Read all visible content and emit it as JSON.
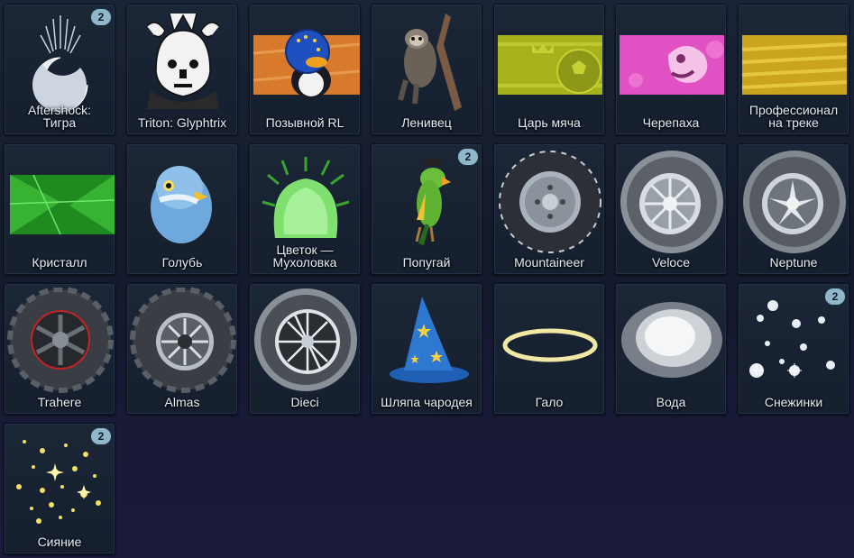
{
  "items": [
    {
      "name": "Aftershock:\nТигра",
      "badge": "2",
      "icon": "aftershock-decal-icon"
    },
    {
      "name": "Triton: Glyphtrix",
      "badge": "",
      "icon": "triton-glyphtrix-icon"
    },
    {
      "name": "Позывной RL",
      "badge": "",
      "icon": "penguin-banner-icon"
    },
    {
      "name": "Ленивец",
      "badge": "",
      "icon": "sloth-topper-icon"
    },
    {
      "name": "Царь мяча",
      "badge": "",
      "icon": "ball-king-banner-icon"
    },
    {
      "name": "Черепаха",
      "badge": "",
      "icon": "turtle-banner-icon"
    },
    {
      "name": "Профессионал\nна треке",
      "badge": "",
      "icon": "track-pro-banner-icon"
    },
    {
      "name": "Кристалл",
      "badge": "",
      "icon": "crystal-banner-icon"
    },
    {
      "name": "Голубь",
      "badge": "",
      "icon": "pigeon-topper-icon"
    },
    {
      "name": "Цветок —\nМухоловка",
      "badge": "",
      "icon": "flytrap-topper-icon"
    },
    {
      "name": "Попугай",
      "badge": "2",
      "icon": "parrot-topper-icon"
    },
    {
      "name": "Mountaineer",
      "badge": "",
      "icon": "wheel-mountaineer-icon"
    },
    {
      "name": "Veloce",
      "badge": "",
      "icon": "wheel-veloce-icon"
    },
    {
      "name": "Neptune",
      "badge": "",
      "icon": "wheel-neptune-icon"
    },
    {
      "name": "Trahere",
      "badge": "",
      "icon": "wheel-trahere-icon"
    },
    {
      "name": "Almas",
      "badge": "",
      "icon": "wheel-almas-icon"
    },
    {
      "name": "Dieci",
      "badge": "",
      "icon": "wheel-dieci-icon"
    },
    {
      "name": "Шляпа чародея",
      "badge": "",
      "icon": "wizard-hat-icon"
    },
    {
      "name": "Гало",
      "badge": "",
      "icon": "halo-icon"
    },
    {
      "name": "Вода",
      "badge": "",
      "icon": "water-boost-icon"
    },
    {
      "name": "Снежинки",
      "badge": "2",
      "icon": "snowflakes-boost-icon"
    },
    {
      "name": "Сияние",
      "badge": "2",
      "icon": "sparkle-boost-icon"
    }
  ]
}
